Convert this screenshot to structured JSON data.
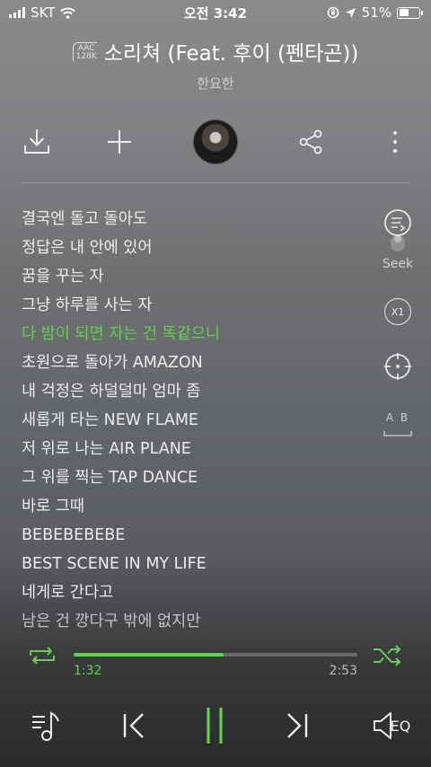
{
  "status_bar": {
    "carrier": "SKT",
    "time": "오전 3:42",
    "battery": "51%",
    "battery_level": 0.51
  },
  "track": {
    "format_line1": "AAC",
    "format_line2": "128K",
    "title": "소리쳐 (Feat. 후이 (펜타곤))",
    "artist": "한요한"
  },
  "actions": {
    "download_icon": "download-icon",
    "add_icon": "plus-icon",
    "share_icon": "share-icon",
    "more_icon": "more-vertical-icon"
  },
  "lyrics": [
    "결국엔 돌고 돌아도",
    "정답은 내 안에 있어",
    "꿈을 꾸는 자",
    "그냥 하루를 사는 자",
    "다 밤이 되면 자는 건 똑같으니",
    "초원으로 돌아가 AMAZON",
    "내 걱정은 하덜덜마 엄마 좀",
    "새롭게 타는 NEW FLAME",
    "저 위로 나는 AIR PLANE",
    "그 위를 찍는 TAP DANCE",
    "바로 그때",
    "BEBEBEBEBE",
    "BEST SCENE IN MY LIFE",
    "네게로 간다고",
    "남은 건 깡다구 밖에 없지만"
  ],
  "current_lyric_index": 4,
  "side_tools": {
    "seek_label": "Seek",
    "speed_label": "X1",
    "ab_label": "A B"
  },
  "playback": {
    "current_time": "1:32",
    "total_time": "2:53",
    "progress": 0.53,
    "accent": "#5fd34a"
  },
  "controls": {
    "eq_label": "EQ"
  }
}
